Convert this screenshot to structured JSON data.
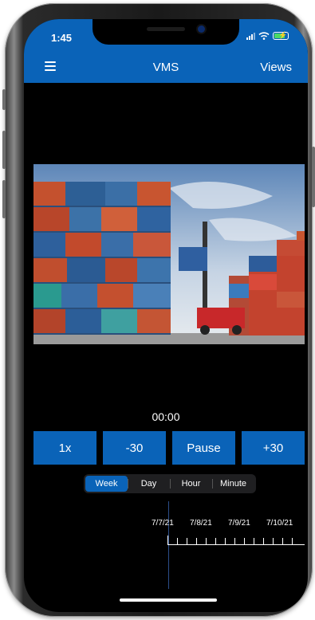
{
  "status": {
    "time": "1:45"
  },
  "nav": {
    "menu_icon": "hamburger-menu-icon",
    "title": "VMS",
    "right_label": "Views"
  },
  "video": {
    "description_icon": "video-frame"
  },
  "player": {
    "timecode": "00:00"
  },
  "controls": [
    {
      "label": "1x"
    },
    {
      "label": "-30"
    },
    {
      "label": "Pause"
    },
    {
      "label": "+30"
    }
  ],
  "segments": [
    {
      "label": "Week",
      "active": true
    },
    {
      "label": "Day",
      "active": false
    },
    {
      "label": "Hour",
      "active": false
    },
    {
      "label": "Minute",
      "active": false
    }
  ],
  "timeline": {
    "dates": [
      "7/7/21",
      "7/8/21",
      "7/9/21",
      "7/10/21"
    ]
  },
  "colors": {
    "accent": "#0a63b8",
    "background": "#000000",
    "segment_bg": "#1f1f21"
  }
}
